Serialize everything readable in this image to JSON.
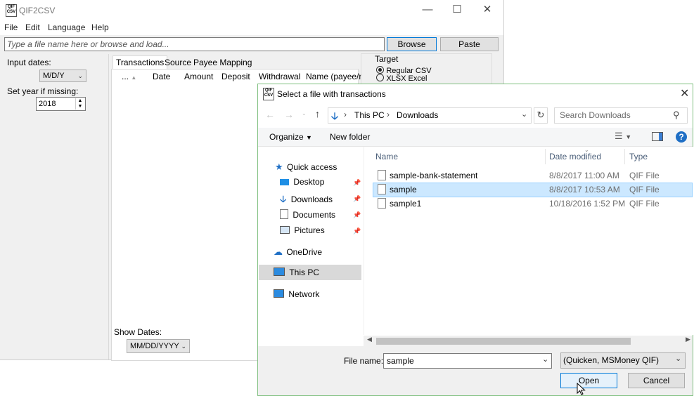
{
  "app": {
    "title": "QIF2CSV",
    "icon_text": "QIF CSV",
    "menu": [
      "File",
      "Edit",
      "Language",
      "Help"
    ],
    "path_placeholder": "Type a file name here or browse and load...",
    "browse_label": "Browse",
    "paste_label": "Paste",
    "input_dates_label": "Input dates:",
    "input_dates_value": "M/D/Y",
    "set_year_label": "Set year if missing:",
    "year_value": "2018",
    "tabs": [
      "Transactions",
      "Source",
      "Payee Mapping"
    ],
    "columns": [
      "...",
      "Date",
      "Amount",
      "Deposit",
      "Withdrawal",
      "Name (payee/r"
    ],
    "target_label": "Target",
    "target_options": [
      "Regular CSV",
      "XLSX Excel"
    ],
    "show_dates_label": "Show Dates:",
    "show_dates_value": "MM/DD/YYYY"
  },
  "dialog": {
    "title": "Select a file with transactions",
    "breadcrumb": [
      "This PC",
      "Downloads"
    ],
    "search_placeholder": "Search Downloads",
    "organize_label": "Organize",
    "new_folder_label": "New folder",
    "nav": {
      "quick_access": "Quick access",
      "pinned": [
        "Desktop",
        "Downloads",
        "Documents",
        "Pictures"
      ],
      "onedrive": "OneDrive",
      "this_pc": "This PC",
      "network": "Network"
    },
    "columns": {
      "name": "Name",
      "date": "Date modified",
      "type": "Type"
    },
    "files": [
      {
        "name": "sample-bank-statement",
        "date": "8/8/2017 11:00 AM",
        "type": "QIF File",
        "selected": false
      },
      {
        "name": "sample",
        "date": "8/8/2017 10:53 AM",
        "type": "QIF File",
        "selected": true
      },
      {
        "name": "sample1",
        "date": "10/18/2016 1:52 PM",
        "type": "QIF File",
        "selected": false
      }
    ],
    "filename_label": "File name:",
    "filename_value": "sample",
    "filter_value": "(Quicken, MSMoney QIF)",
    "open_label": "Open",
    "cancel_label": "Cancel"
  },
  "colors": {
    "selection": "#cce8ff",
    "selection_border": "#99d1ff",
    "accent": "#0078d7",
    "folder_blue": "#1f6fc5"
  }
}
